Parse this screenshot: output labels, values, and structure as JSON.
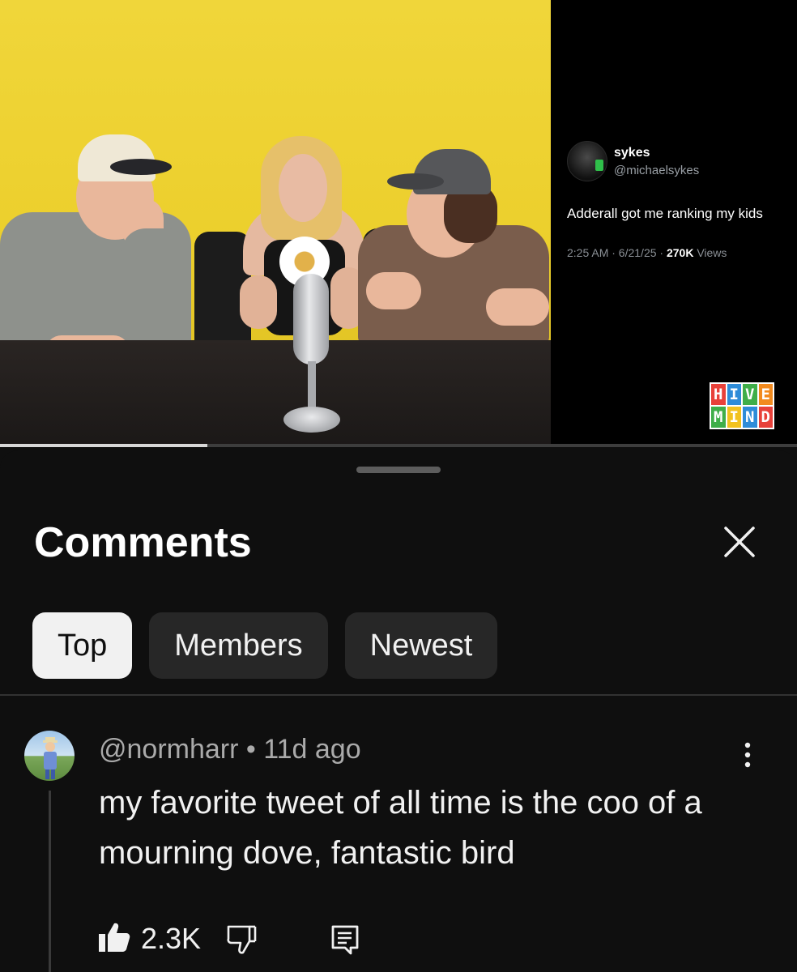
{
  "video": {
    "progress_fraction": 0.26,
    "tweet": {
      "name": "sykes",
      "handle": "@michaelsykes",
      "text": "Adderall got me ranking my kids",
      "time_date": "2:25 AM · 6/21/25 · ",
      "views_count": "270K",
      "views_label": " Views"
    },
    "logo": {
      "letters": [
        "H",
        "I",
        "V",
        "E",
        "M",
        "I",
        "N",
        "D"
      ],
      "colors": [
        "#e8413a",
        "#2e8cd8",
        "#3fae49",
        "#f28a1e",
        "#3fae49",
        "#f2c21e",
        "#2e8cd8",
        "#e8413a"
      ]
    }
  },
  "comments_panel": {
    "title": "Comments",
    "tabs": [
      {
        "label": "Top",
        "active": true
      },
      {
        "label": "Members",
        "active": false
      },
      {
        "label": "Newest",
        "active": false
      }
    ],
    "comment": {
      "author": "@normharr",
      "separator": " • ",
      "age": "11d ago",
      "text": "my favorite tweet of all time is the coo of a mourning dove, fantastic bird",
      "likes": "2.3K"
    }
  },
  "colors": {
    "background": "#0f0f0f",
    "chip_active": "#f1f1f1",
    "chip_inactive": "#272727",
    "text_secondary": "#aaaaaa"
  }
}
